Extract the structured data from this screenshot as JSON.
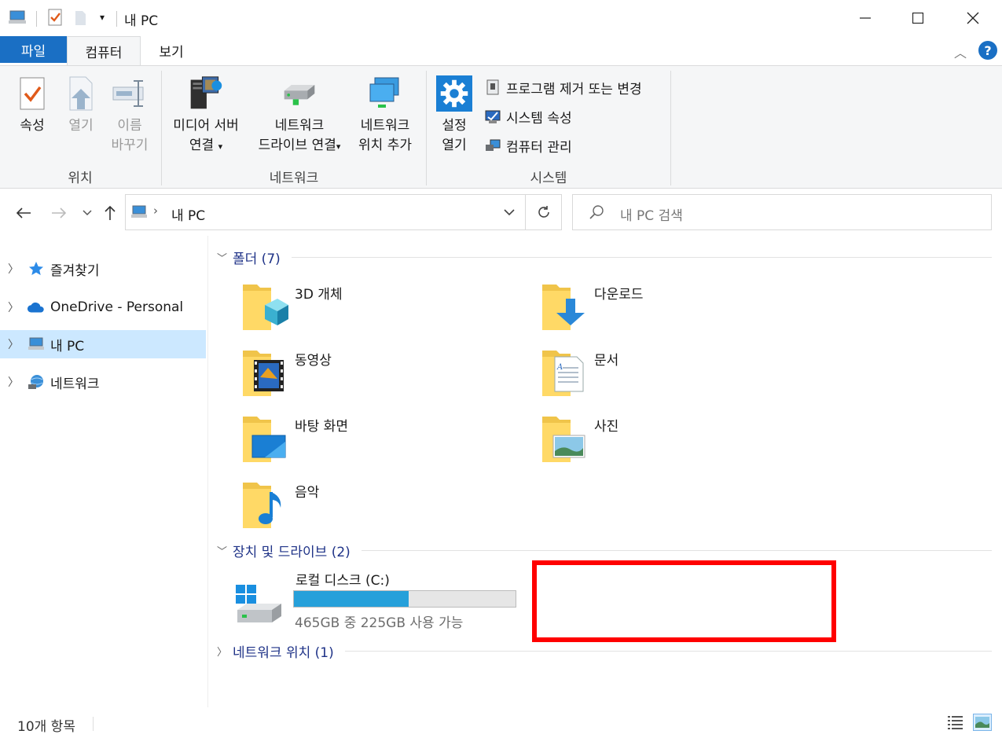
{
  "window": {
    "title": "내 PC"
  },
  "ribbon": {
    "tabs": [
      "파일",
      "컴퓨터",
      "보기"
    ],
    "groups": {
      "location": {
        "label": "위치",
        "properties": "속성",
        "open": "열기",
        "rename_line1": "이름",
        "rename_line2": "바꾸기"
      },
      "network": {
        "label": "네트워크",
        "media_line1": "미디어 서버",
        "media_line2": "연결",
        "map_line1": "네트워크",
        "map_line2": "드라이브 연결",
        "add_line1": "네트워크",
        "add_line2": "위치 추가"
      },
      "system": {
        "label": "시스템",
        "settings_line1": "설정",
        "settings_line2": "열기",
        "uninstall": "프로그램 제거 또는 변경",
        "system_props": "시스템 속성",
        "manage": "컴퓨터 관리"
      }
    }
  },
  "address": {
    "path": "내 PC",
    "search_placeholder": "내 PC 검색"
  },
  "nav": {
    "items": [
      "즐겨찾기",
      "OneDrive - Personal",
      "내 PC",
      "네트워크"
    ],
    "selected": "내 PC"
  },
  "content": {
    "folders_header": "폴더 (7)",
    "folders": [
      "3D 개체",
      "다운로드",
      "동영상",
      "문서",
      "바탕 화면",
      "사진",
      "음악"
    ],
    "devices_header": "장치 및 드라이브 (2)",
    "drive": {
      "name": "로컬 디스크 (C:)",
      "free_text": "465GB 중 225GB 사용 가능",
      "used_fraction": 0.516
    },
    "network_header": "네트워크 위치 (1)"
  },
  "status": {
    "item_count": "10개 항목"
  },
  "colors": {
    "accent": "#1a6fc4",
    "selection": "#cce8ff",
    "drive_fill": "#26a0da",
    "highlight_box": "#ff0000"
  }
}
